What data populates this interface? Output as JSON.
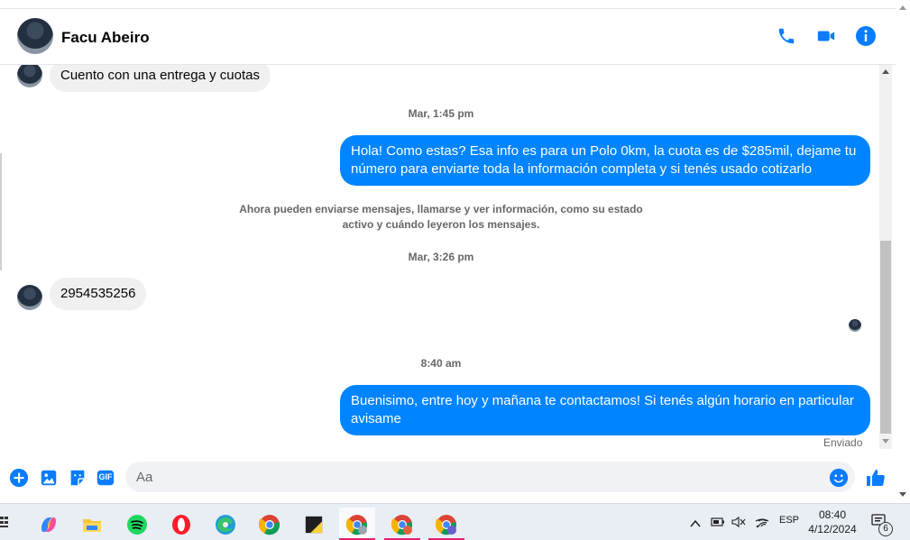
{
  "header": {
    "contact_name": "Facu Abeiro",
    "icons": [
      "phone-icon",
      "video-camera-icon",
      "info-icon"
    ]
  },
  "conversation": {
    "msg_in_1": "Cuento con una entrega y cuotas",
    "ts_1": "Mar, 1:45 pm",
    "msg_out_1": "Hola! Como estas? Esa info es para un Polo 0km, la cuota es de $285mil, dejame tu número para enviarte toda la información completa y si tenés usado cotizarlo",
    "notice_line_1": "Ahora pueden enviarse mensajes, llamarse y ver información, como su estado",
    "notice_line_2": "activo y cuándo leyeron los mensajes.",
    "ts_2": "Mar, 3:26 pm",
    "msg_in_2": "2954535256",
    "ts_3": "8:40 am",
    "msg_out_2": "Buenisimo, entre hoy y mañana te contactamos! Si tenés algún horario en particular avisame",
    "status": "Enviado"
  },
  "composer": {
    "placeholder": "Aa",
    "gif_label": "GIF",
    "icons": [
      "plus-icon",
      "image-icon",
      "sticker-icon",
      "gif-icon",
      "emoji-icon",
      "thumbs-up-icon"
    ]
  },
  "taskbar": {
    "apps": [
      "copilot-icon",
      "file-explorer-icon",
      "spotify-icon",
      "opera-icon",
      "edge-icon",
      "chrome-icon",
      "sticky-notes-icon",
      "chrome-profile-y-icon",
      "chrome-profile-r-icon",
      "chrome-profile-c-icon"
    ],
    "language": "ESP",
    "time": "08:40",
    "date": "4/12/2024",
    "notification_count": "6",
    "accent_color": "#e0236f"
  },
  "colors": {
    "outgoing_bubble": "#0084ff",
    "incoming_bubble": "#f0f0f0",
    "icon_blue": "#0a7cff"
  }
}
